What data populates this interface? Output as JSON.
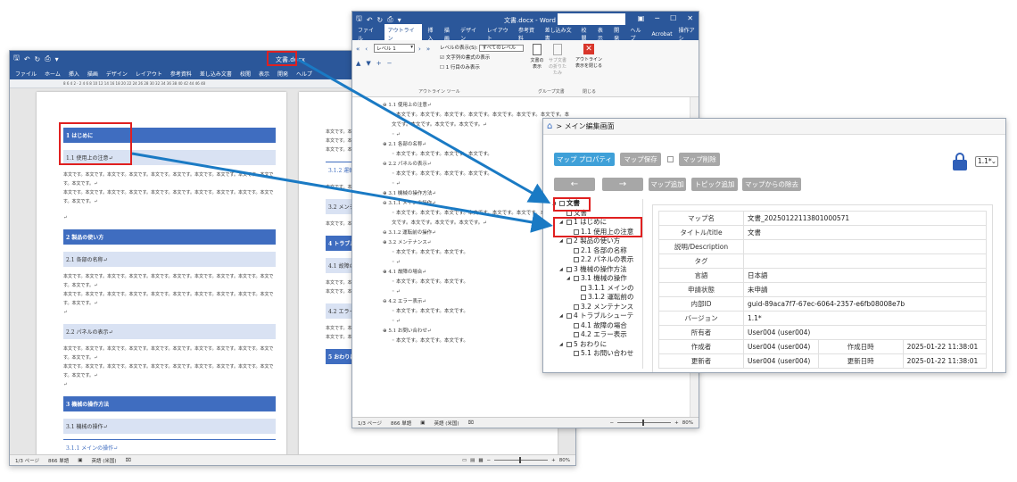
{
  "left_word": {
    "title": "文書.docx",
    "menu": [
      "ファイル",
      "ホーム",
      "挿入",
      "描画",
      "デザイン",
      "レイアウト",
      "参考資料",
      "差し込み文書",
      "校閲",
      "表示",
      "開発",
      "ヘルプ"
    ],
    "ruler": "8 6 4 2 · 2 4 6 8 10 12 14 16 18 20 22 24 26 28 30 32 34 36 38 40 42 44 46 48",
    "page1": {
      "h1_intro": "1 はじめに",
      "h2_usage": "1.1 使用上の注意↵",
      "body": "本文です。本文です。本文です。本文です。本文です。本文です。本文です。本文です。本文です。本文です。本文です。↵",
      "empty": "↵",
      "h1_parts": "2 製品の使い方",
      "h2_names": "2.1 各部の名称↵",
      "h2_panel": "2.2 パネルの表示↵",
      "h1_ops": "3 機械の操作方法",
      "h2_ops": "3.1 機械の操作↵",
      "h3_main": "3.1.1 メインの操作↵"
    },
    "page2": {
      "body": "本文です。本文です。↵",
      "h3_sub": "3.1.2 運転↵",
      "h2_maint": "3.2 メンテ",
      "h1_trouble": "4 トラブル",
      "h2_fail": "4.1 故障の",
      "h2_err": "4.2 エラー",
      "h1_end": "5 おわりに"
    },
    "status": {
      "page": "1/3 ページ",
      "words": "866 単語",
      "lang": "英語 (米国)",
      "zoom": "80%"
    }
  },
  "outline_word": {
    "title": "文書.docx - Word",
    "tabs": [
      "ファイル",
      "アウトライン",
      "挿入",
      "描画",
      "デザイン",
      "レイアウト",
      "参考資料",
      "差し込み文書",
      "校閲",
      "表示",
      "開発",
      "ヘルプ",
      "Acrobat",
      "操作アシ"
    ],
    "ribbon": {
      "level_value": "レベル 1",
      "show_level_label": "レベルの表示(S):",
      "show_level_value": "すべてのレベル",
      "show_format": "文字列の書式の表示",
      "first_line_only": "1 行目のみ表示",
      "outline_tools": "アウトライン ツール",
      "show_doc": "文書の表示",
      "collapse_sub": "サブ文書の折りたたみ",
      "group_doc": "グループ文書",
      "close_view": "アウトライン表示を閉じる",
      "close": "閉じる"
    },
    "lines": [
      "⊖ 1.1 使用上の注意↵",
      "◦ 本文です。本文です。本文です。本文です。本文です。本文です。本文です。本",
      "  文です。本文です。本文です。本文です。↵",
      "◦ ↵",
      "⊕ 2.1 各部の名称↵",
      "◦ 本文です。本文です。本文です。本文です。",
      "⊖ 2.2 パネルの表示↵",
      "◦ 本文です。本文です。本文です。本文です。",
      "◦ ↵",
      "⊕ 3.1 機械の操作方法↵",
      "⊖ 3.1.1 メインの操作↵",
      "◦ 本文です。本文です。本文です。本文です。本文です。本文です。本文です。本",
      "  文です。本文です。本文です。本文です。↵",
      "⊖ 3.1.2 運転前の操作↵",
      "⊕ 3.2 メンテナンス↵",
      "◦ 本文です。本文です。本文です。",
      "◦ ↵",
      "⊕ 4.1 故障の場合↵",
      "◦ 本文です。本文です。本文です。",
      "◦ ↵",
      "⊖ 4.2 エラー表示↵",
      "◦ 本文です。本文です。本文です。",
      "◦ ↵",
      "⊕ 5.1 お問い合わせ↵",
      "◦ 本文です。本文です。本文です。"
    ],
    "status": {
      "page": "1/3 ページ",
      "words": "866 単語",
      "lang": "英語 (米国)",
      "zoom": "80%"
    }
  },
  "app": {
    "breadcrumb": "> メイン編集画面",
    "btn_props": "マップ プロパティ",
    "btn_save": "マップ保存",
    "btn_delete": "マップ削除",
    "btn_back": "←",
    "btn_forward": "→",
    "btn_add_map": "マップ追加",
    "btn_add_topic": "トピック追加",
    "btn_remove": "マップからの除去",
    "version_select": "1.1*",
    "tree": [
      {
        "label": "文書",
        "indent": 0,
        "exp": "◢"
      },
      {
        "label": "文書",
        "indent": 1,
        "exp": ""
      },
      {
        "label": "1 はじめに",
        "indent": 1,
        "exp": "◢"
      },
      {
        "label": "1.1 使用上の注意",
        "indent": 2,
        "exp": ""
      },
      {
        "label": "2 製品の使い方",
        "indent": 1,
        "exp": "◢"
      },
      {
        "label": "2.1 各部の名称",
        "indent": 2,
        "exp": ""
      },
      {
        "label": "2.2 パネルの表示",
        "indent": 2,
        "exp": ""
      },
      {
        "label": "3 機械の操作方法",
        "indent": 1,
        "exp": "◢"
      },
      {
        "label": "3.1 機械の操作",
        "indent": 2,
        "exp": "◢"
      },
      {
        "label": "3.1.1 メインの",
        "indent": 3,
        "exp": ""
      },
      {
        "label": "3.1.2 運転前の",
        "indent": 3,
        "exp": ""
      },
      {
        "label": "3.2 メンテナンス",
        "indent": 2,
        "exp": ""
      },
      {
        "label": "4 トラブルシューテ",
        "indent": 1,
        "exp": "◢"
      },
      {
        "label": "4.1 故障の場合",
        "indent": 2,
        "exp": ""
      },
      {
        "label": "4.2 エラー表示",
        "indent": 2,
        "exp": ""
      },
      {
        "label": "5 おわりに",
        "indent": 1,
        "exp": "◢"
      },
      {
        "label": "5.1 お問い合わせ",
        "indent": 2,
        "exp": ""
      }
    ],
    "props": {
      "map_name_k": "マップ名",
      "map_name_v": "文書_20250122113801000571",
      "title_k": "タイトル/title",
      "title_v": "文書",
      "desc_k": "説明/Description",
      "desc_v": "",
      "tag_k": "タグ",
      "tag_v": "",
      "lang_k": "言語",
      "lang_v": "日本語",
      "apply_k": "申請状態",
      "apply_v": "未申請",
      "id_k": "内部ID",
      "id_v": "guid-89aca7f7-67ec-6064-2357-e6fb08008e7b",
      "ver_k": "バージョン",
      "ver_v": "1.1*",
      "owner_k": "所有者",
      "owner_v": "User004 (user004)",
      "creator_k": "作成者",
      "creator_v": "User004 (user004)",
      "created_k": "作成日時",
      "created_v": "2025-01-22 11:38:01",
      "updater_k": "更新者",
      "updater_v": "User004 (user004)",
      "updated_k": "更新日時",
      "updated_v": "2025-01-22 11:38:01"
    }
  },
  "colors": {
    "word_blue": "#2b579a",
    "heading_blue": "#3f6dc0",
    "app_blue": "#3fa0d8",
    "gray_btn": "#a7a7a7",
    "arrow_blue": "#1a7ac4",
    "red": "#e02020"
  }
}
